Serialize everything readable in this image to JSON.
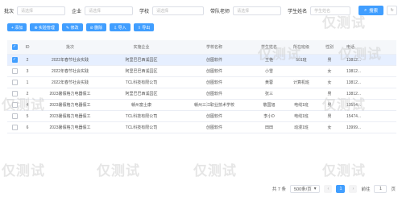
{
  "filters": {
    "batch_label": "批次",
    "batch_placeholder": "请选择",
    "enterprise_label": "企业",
    "enterprise_placeholder": "请选择",
    "school_label": "学校",
    "school_placeholder": "请选择",
    "teacher_label": "带队老师",
    "teacher_placeholder": "请选择",
    "student_label": "学生姓名",
    "student_placeholder": "学生姓名",
    "search_label": "搜索"
  },
  "actions": [
    "+ 添加",
    "⊗ 实验管理",
    "✎ 修改",
    "⊘ 删除",
    "⇩ 导入",
    "⇧ 导出"
  ],
  "table": {
    "headers": [
      "ID",
      "批次",
      "实施企业",
      "学校名称",
      "学生姓名",
      "所在班级",
      "性别",
      "电话"
    ],
    "rows": [
      {
        "id": "2",
        "batch": "2022年春节社会实践",
        "ent": "阿里巴巴西溪园区",
        "school": "创图软件",
        "stu": "王艳",
        "cls": "501班",
        "sex": "男",
        "phone": "13812...",
        "selected": true
      },
      {
        "id": "3",
        "batch": "2022年春节社会实践",
        "ent": "阿里巴巴西溪园区",
        "school": "创图软件",
        "stu": "小雪",
        "cls": "",
        "sex": "女",
        "phone": "13812...",
        "selected": false
      },
      {
        "id": "1",
        "batch": "2022年春节社会实践",
        "ent": "TCL科技有限公司",
        "school": "创图软件",
        "stu": "黄蓉",
        "cls": "计算机班",
        "sex": "女",
        "phone": "13812...",
        "selected": false
      },
      {
        "id": "2",
        "batch": "2023暑假格力电器假工",
        "ent": "阿里巴巴西溪园区",
        "school": "创图软件",
        "stu": "张三",
        "cls": "",
        "sex": "男",
        "phone": "13812...",
        "selected": false
      },
      {
        "id": "4",
        "batch": "2023暑假格力电器假工",
        "ent": "赣州富士康",
        "school": "赣州三江职业技术学校",
        "stu": "敬国旭",
        "cls": "电线1班",
        "sex": "男",
        "phone": "13554...",
        "selected": false
      },
      {
        "id": "5",
        "batch": "2023暑假格力电器假工",
        "ent": "TCL科技有限公司",
        "school": "创图软件",
        "stu": "李小D",
        "cls": "电线1班",
        "sex": "男",
        "phone": "15474...",
        "selected": false
      },
      {
        "id": "6",
        "batch": "2023暑假格力电器假工",
        "ent": "TCL科技有限公司",
        "school": "创图软件",
        "stu": "田田",
        "cls": "动漫1班",
        "sex": "女",
        "phone": "13999...",
        "selected": false
      }
    ]
  },
  "pagination": {
    "total": "共 7 条",
    "page_size": "500条/页",
    "current": "1",
    "goto_label": "前往",
    "goto_value": "1",
    "page_unit": "页"
  },
  "watermark": "仅测试"
}
